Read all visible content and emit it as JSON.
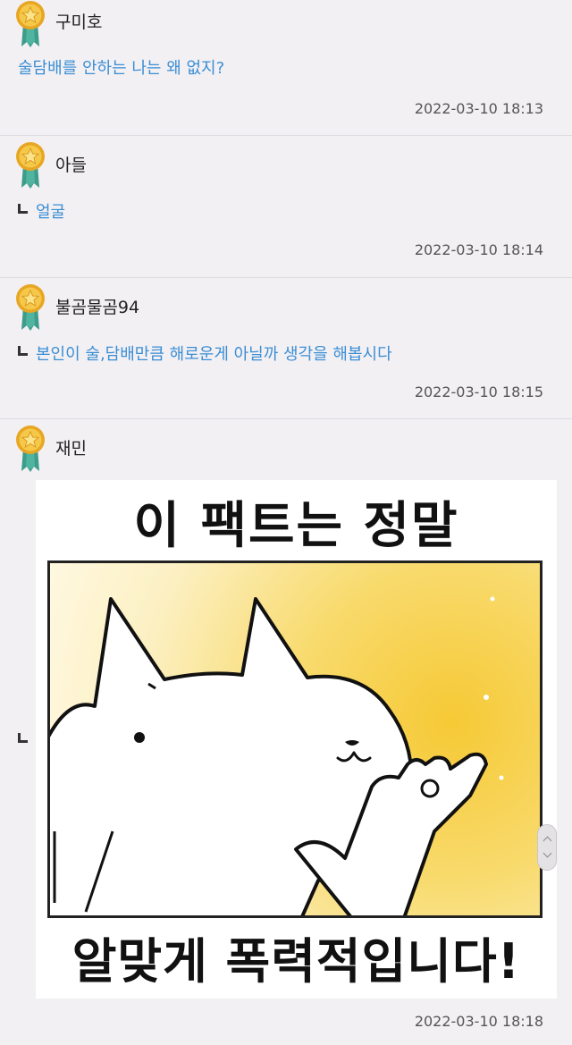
{
  "comments": [
    {
      "username": "구미호",
      "text": "술담배를 안하는 나는 왜 없지?",
      "timestamp": "2022-03-10 18:13"
    },
    {
      "username": "아들",
      "text": "얼굴",
      "timestamp": "2022-03-10 18:14"
    },
    {
      "username": "불곰물곰94",
      "text": "본인이 술,담배만큼 해로운게 아닐까 생각을 해봅시다",
      "timestamp": "2022-03-10 18:15"
    },
    {
      "username": "재민",
      "image_caption_top": "이 팩트는 정말",
      "image_caption_bottom": "알맞게 폭력적입니다!",
      "timestamp": "2022-03-10 18:18"
    }
  ],
  "colors": {
    "link": "#3a8ed3",
    "background": "#f3f0f4",
    "medal": "#f0b92c",
    "ribbon": "#3d9c8a"
  },
  "icons": {
    "badge": "medal-icon",
    "reply": "reply-arrow-icon",
    "scroll": "scroll-handle-icon"
  }
}
